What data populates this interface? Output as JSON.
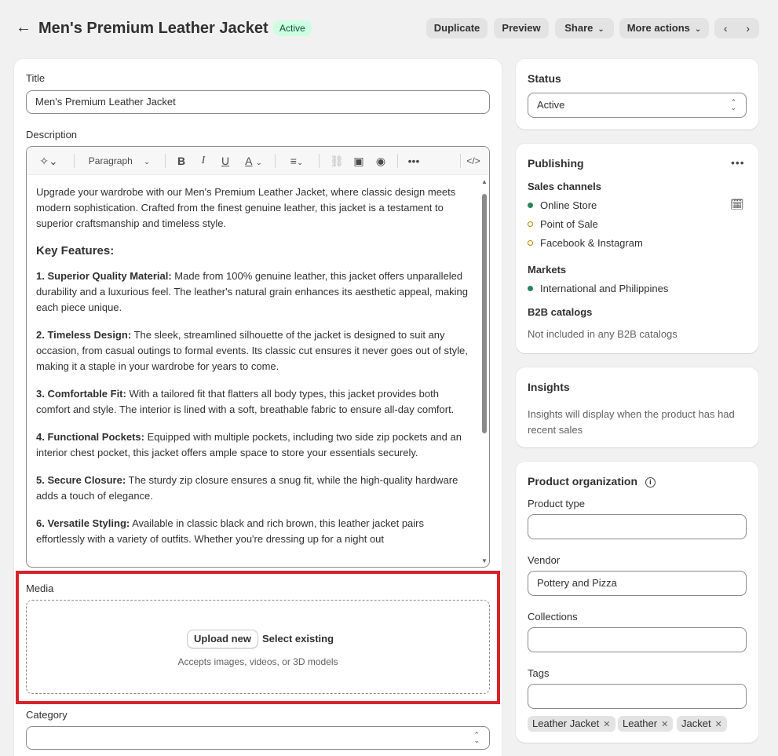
{
  "header": {
    "back_icon": "arrow-left-icon",
    "title": "Men's Premium Leather Jacket",
    "status_badge": "Active",
    "duplicate_label": "Duplicate",
    "preview_label": "Preview",
    "share_label": "Share",
    "more_actions_label": "More actions",
    "prev_icon": "chevron-left-icon",
    "next_icon": "chevron-right-icon"
  },
  "main": {
    "title_label": "Title",
    "title_value": "Men's Premium Leather Jacket",
    "description_label": "Description",
    "toolbar": {
      "paragraph_label": "Paragraph",
      "bold": "B",
      "italic": "I",
      "underline": "U",
      "text_color": "A"
    },
    "description": {
      "intro": "Upgrade your wardrobe with our Men's Premium Leather Jacket, where classic design meets modern sophistication. Crafted from the finest genuine leather, this jacket is a testament to superior craftsmanship and timeless style.",
      "features_heading": "Key Features:",
      "features": [
        {
          "title": "1. Superior Quality Material:",
          "text": " Made from 100% genuine leather, this jacket offers unparalleled durability and a luxurious feel. The leather's natural grain enhances its aesthetic appeal, making each piece unique."
        },
        {
          "title": "2. Timeless Design:",
          "text": " The sleek, streamlined silhouette of the jacket is designed to suit any occasion, from casual outings to formal events. Its classic cut ensures it never goes out of style, making it a staple in your wardrobe for years to come."
        },
        {
          "title": "3. Comfortable Fit:",
          "text": " With a tailored fit that flatters all body types, this jacket provides both comfort and style. The interior is lined with a soft, breathable fabric to ensure all-day comfort."
        },
        {
          "title": "4. Functional Pockets:",
          "text": " Equipped with multiple pockets, including two side zip pockets and an interior chest pocket, this jacket offers ample space to store your essentials securely."
        },
        {
          "title": "5. Secure Closure:",
          "text": " The sturdy zip closure ensures a snug fit, while the high-quality hardware adds a touch of elegance."
        },
        {
          "title": "6. Versatile Styling:",
          "text": " Available in classic black and rich brown, this leather jacket pairs effortlessly with a variety of outfits. Whether you're dressing up for a night out"
        }
      ]
    },
    "media": {
      "label": "Media",
      "upload_label": "Upload new",
      "select_existing_label": "Select existing",
      "accepts_text": "Accepts images, videos, or 3D models"
    },
    "category_label": "Category"
  },
  "sidebar": {
    "status": {
      "title": "Status",
      "selected": "Active"
    },
    "publishing": {
      "title": "Publishing",
      "sales_channels_label": "Sales channels",
      "channels": [
        "Online Store",
        "Point of Sale",
        "Facebook & Instagram"
      ],
      "markets_label": "Markets",
      "market": "International and Philippines",
      "b2b_label": "B2B catalogs",
      "b2b_text": "Not included in any B2B catalogs"
    },
    "insights": {
      "title": "Insights",
      "text": "Insights will display when the product has had recent sales"
    },
    "organization": {
      "title": "Product organization",
      "product_type_label": "Product type",
      "vendor_label": "Vendor",
      "vendor_value": "Pottery and Pizza",
      "collections_label": "Collections",
      "tags_label": "Tags",
      "tags": [
        "Leather Jacket",
        "Leather",
        "Jacket"
      ]
    }
  },
  "colors": {
    "active_badge_bg": "#cdfee1",
    "active_badge_text": "#0c5132",
    "highlight_border": "#d8232a",
    "published_dot": "#29845a",
    "unpublished_dot": "#b28400"
  }
}
